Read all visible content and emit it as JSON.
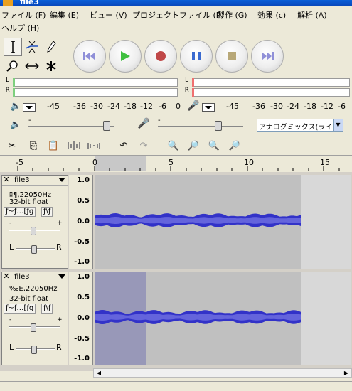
{
  "window": {
    "title": "file3"
  },
  "menu": {
    "items": [
      "ファイル (F)",
      "編集 (E)",
      "ビュー (V)",
      "プロジェクトファイル (P)",
      "製作 (G)",
      "効果 (c)",
      "解析 (A)",
      "ヘルプ (H)"
    ]
  },
  "meters": {
    "channels": [
      "L",
      "R"
    ],
    "scale": [
      "-45",
      "-36",
      "-30",
      "-24",
      "-18",
      "-12",
      "-6",
      "0"
    ]
  },
  "mixer": {
    "input_source": "アナログミックス(ライン/CD"
  },
  "ruler": {
    "labels": [
      "-5",
      "0",
      "5",
      "10",
      "15"
    ]
  },
  "tracks": [
    {
      "name": "file3",
      "rate_line": "ﾛ¶,22050Hz",
      "format": "32-bit float",
      "mute_label": "ƒ~ƒ…[ƒg",
      "solo_label": "ƒ\\ƒ",
      "gain_minus": "-",
      "gain_plus": "+",
      "pan_left": "L",
      "pan_right": "R",
      "vruler": [
        "1.0",
        "0.5",
        "0.0",
        "-0.5",
        "-1.0"
      ]
    },
    {
      "name": "file3",
      "rate_line": "‰E,22050Hz",
      "format": "32-bit float",
      "mute_label": "ƒ~ƒ…[ƒg",
      "solo_label": "ƒ\\ƒ",
      "gain_minus": "-",
      "gain_plus": "+",
      "pan_left": "L",
      "pan_right": "R",
      "vruler": [
        "1.0",
        "0.5",
        "0.0",
        "-0.5",
        "-1.0"
      ]
    }
  ],
  "colors": {
    "waveform": "#3232c8",
    "waveform_rms": "#6464dc",
    "selected_bg": "#9898b8",
    "track_bg": "#c0c0c0",
    "track_after": "#d8d8d8"
  }
}
